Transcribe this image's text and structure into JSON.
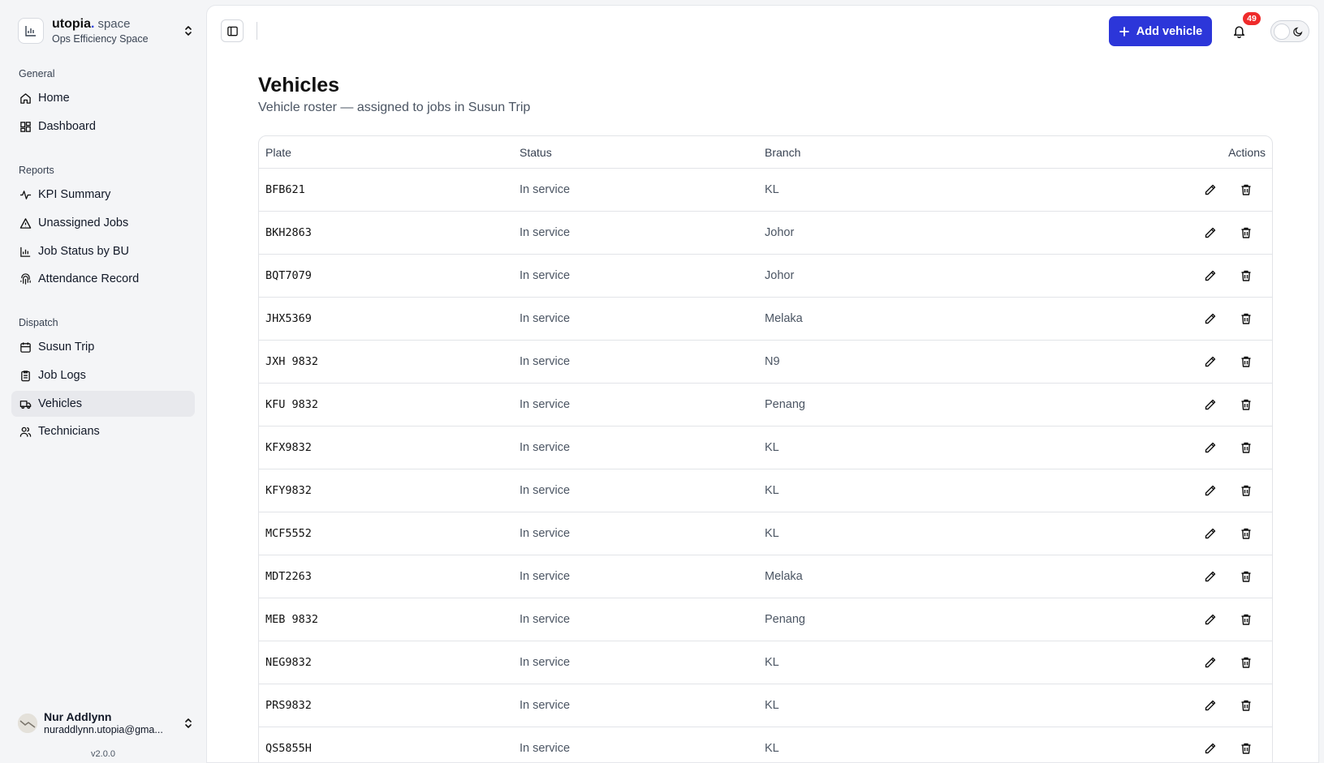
{
  "workspace": {
    "brand": "utopia",
    "brand_dot": ".",
    "brand_suffix": "space",
    "name": "Ops Efficiency Space"
  },
  "sidebar": {
    "sections": [
      {
        "label": "General",
        "items": [
          {
            "label": "Home",
            "icon": "home-icon"
          },
          {
            "label": "Dashboard",
            "icon": "dashboard-icon"
          }
        ]
      },
      {
        "label": "Reports",
        "items": [
          {
            "label": "KPI Summary",
            "icon": "activity-icon"
          },
          {
            "label": "Unassigned Jobs",
            "icon": "warning-triangle-icon"
          },
          {
            "label": "Job Status by BU",
            "icon": "bar-chart-icon"
          },
          {
            "label": "Attendance Record",
            "icon": "fingerprint-icon"
          }
        ]
      },
      {
        "label": "Dispatch",
        "items": [
          {
            "label": "Susun Trip",
            "icon": "calendar-icon"
          },
          {
            "label": "Job Logs",
            "icon": "clipboard-icon"
          },
          {
            "label": "Vehicles",
            "icon": "truck-icon",
            "active": true
          },
          {
            "label": "Technicians",
            "icon": "users-icon"
          }
        ]
      }
    ]
  },
  "user": {
    "name": "Nur Addlynn",
    "email": "nuraddlynn.utopia@gma..."
  },
  "version": "v2.0.0",
  "header": {
    "add_label": "Add vehicle",
    "notification_count": "49"
  },
  "page": {
    "title": "Vehicles",
    "subtitle": "Vehicle roster — assigned to jobs in Susun Trip"
  },
  "table": {
    "headers": {
      "plate": "Plate",
      "status": "Status",
      "branch": "Branch",
      "actions": "Actions"
    },
    "rows": [
      {
        "plate": "BFB621",
        "status": "In service",
        "branch": "KL"
      },
      {
        "plate": "BKH2863",
        "status": "In service",
        "branch": "Johor"
      },
      {
        "plate": "BQT7079",
        "status": "In service",
        "branch": "Johor"
      },
      {
        "plate": "JHX5369",
        "status": "In service",
        "branch": "Melaka"
      },
      {
        "plate": "JXH 9832",
        "status": "In service",
        "branch": "N9"
      },
      {
        "plate": "KFU 9832",
        "status": "In service",
        "branch": "Penang"
      },
      {
        "plate": "KFX9832",
        "status": "In service",
        "branch": "KL"
      },
      {
        "plate": "KFY9832",
        "status": "In service",
        "branch": "KL"
      },
      {
        "plate": "MCF5552",
        "status": "In service",
        "branch": "KL"
      },
      {
        "plate": "MDT2263",
        "status": "In service",
        "branch": "Melaka"
      },
      {
        "plate": "MEB 9832",
        "status": "In service",
        "branch": "Penang"
      },
      {
        "plate": "NEG9832",
        "status": "In service",
        "branch": "KL"
      },
      {
        "plate": "PRS9832",
        "status": "In service",
        "branch": "KL"
      },
      {
        "plate": "QS5855H",
        "status": "In service",
        "branch": "KL"
      }
    ]
  },
  "colors": {
    "accent": "#2c36d9",
    "badge": "#ef2b2b"
  }
}
